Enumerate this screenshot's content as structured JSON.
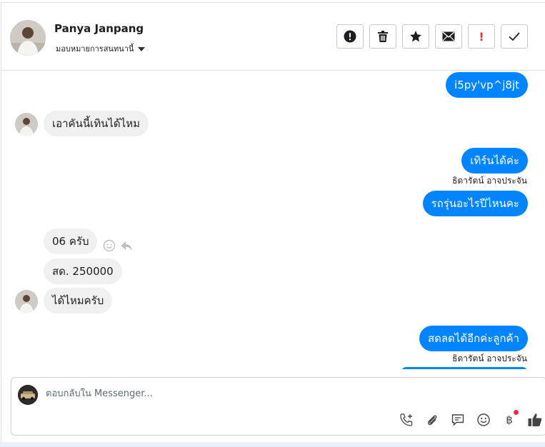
{
  "header": {
    "contact_name": "Panya Janpang",
    "assign_label": "มอบหมายการสนทนานี้",
    "toolbar": [
      {
        "id": "spam",
        "icon": "alert-circle-icon"
      },
      {
        "id": "delete",
        "icon": "trash-icon"
      },
      {
        "id": "star",
        "icon": "star-icon"
      },
      {
        "id": "unread",
        "icon": "envelope-icon"
      },
      {
        "id": "follow-up",
        "icon": "exclamation-icon",
        "text": "!"
      },
      {
        "id": "done",
        "icon": "check-icon"
      }
    ]
  },
  "messages": [
    {
      "dir": "out",
      "text": "i5py'vp^j8jt"
    },
    {
      "dir": "in",
      "text": "เอาคันนี้เทินได้ไหม"
    },
    {
      "dir": "out",
      "text": "เทิร์นได้ค่ะ",
      "sender": "ธิดารัตน์ อาจประจัน"
    },
    {
      "dir": "out",
      "text": "รถรุ่นอะไรปีไหนคะ"
    },
    {
      "dir": "in",
      "text": "06 ครับ"
    },
    {
      "dir": "in",
      "text": "สด.  250000"
    },
    {
      "dir": "in",
      "text": "ได้ไหมครับ"
    },
    {
      "dir": "out",
      "text": "สดลดได้อีกค่ะลูกค้า",
      "sender": "ธิดารัตน์ อาจประจัน"
    }
  ],
  "composer": {
    "placeholder": "ตอบกลับใน Messenger...",
    "value": "",
    "tools": [
      "call-add-icon",
      "paperclip-icon",
      "saved-reply-icon",
      "emoji-icon",
      "baht-payment-icon",
      "like-icon"
    ],
    "baht_symbol": "฿"
  },
  "colors": {
    "outgoing_bubble": "#0084ff",
    "incoming_bubble": "#f0f0f0",
    "alert_red": "#e4343c"
  }
}
